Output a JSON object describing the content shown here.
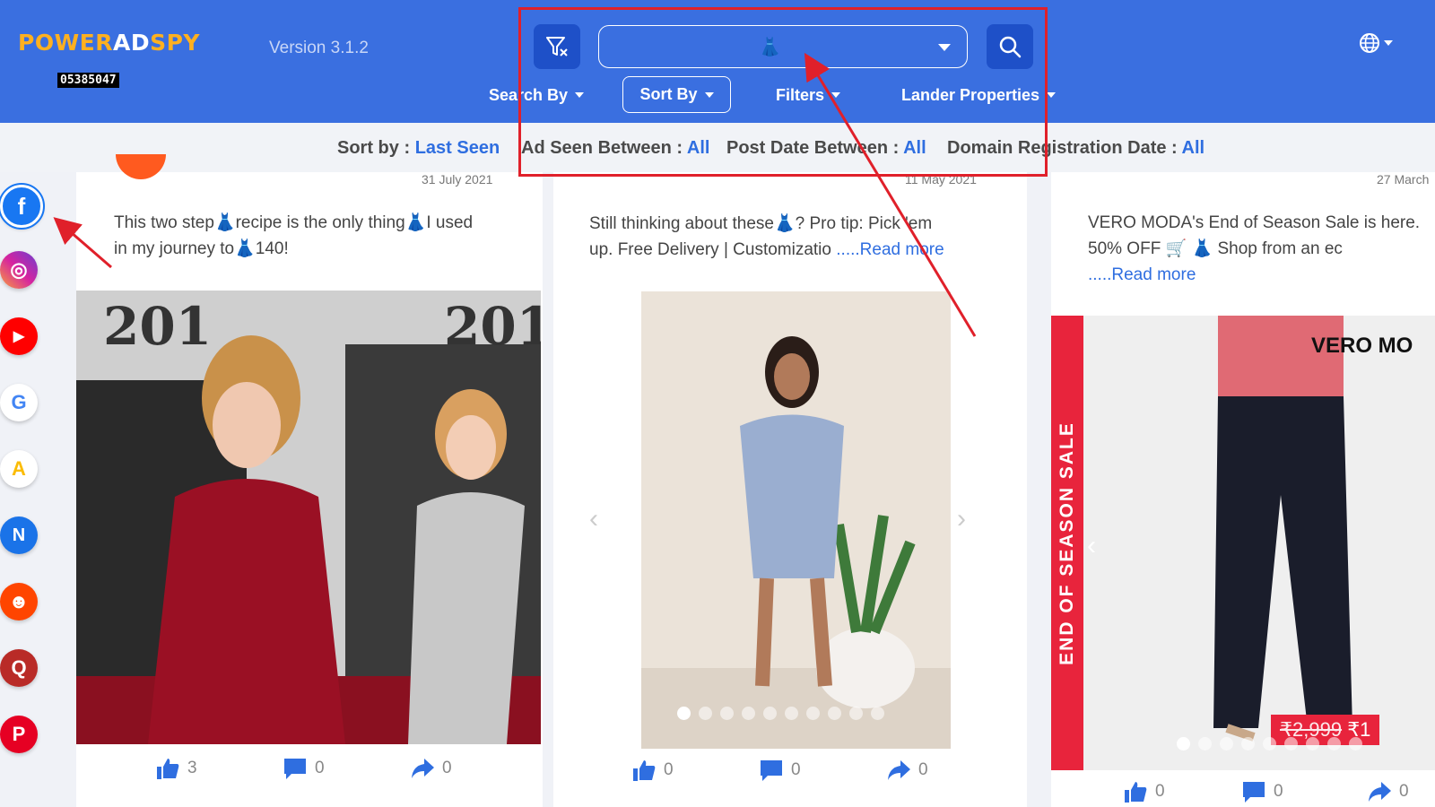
{
  "header": {
    "logo_part1": "POWER",
    "logo_part2": "AD",
    "logo_part3": "SPY",
    "user_id": "05385047",
    "version": "Version 3.1.2",
    "search_emoji": "👗",
    "menu": {
      "search_by": "Search By",
      "sort_by": "Sort By",
      "filters": "Filters",
      "lander_properties": "Lander Properties"
    }
  },
  "subbar": {
    "sort_label": "Sort by :",
    "sort_value": "Last Seen",
    "ad_seen_label": "Ad Seen Between :",
    "ad_seen_value": "All",
    "post_date_label": "Post Date Between :",
    "post_date_value": "All",
    "domain_reg_label": "Domain Registration Date :",
    "domain_reg_value": "All"
  },
  "sidebar": {
    "items": [
      {
        "name": "facebook",
        "glyph": "f",
        "color": "#1877f2"
      },
      {
        "name": "instagram",
        "glyph": "◎",
        "color": "#d6249f"
      },
      {
        "name": "youtube",
        "glyph": "▶",
        "color": "#ff0000"
      },
      {
        "name": "google",
        "glyph": "G",
        "color": "#ffffff"
      },
      {
        "name": "google-ads",
        "glyph": "A",
        "color": "#ffffff"
      },
      {
        "name": "native",
        "glyph": "N",
        "color": "#1a73e8"
      },
      {
        "name": "reddit",
        "glyph": "☻",
        "color": "#ff4500"
      },
      {
        "name": "quora",
        "glyph": "Q",
        "color": "#b92b27"
      },
      {
        "name": "pinterest",
        "glyph": "P",
        "color": "#e60023"
      }
    ]
  },
  "cards": [
    {
      "date": "31 July 2021",
      "text_line1_a": "This two step",
      "text_line1_b": "recipe is the only thing",
      "text_line1_c": "I used",
      "text_line2_a": "in my journey to",
      "text_line2_b": "140!",
      "emoji": "👗",
      "likes": "3",
      "comments": "0",
      "shares": "0"
    },
    {
      "date": "11 May 2021",
      "text_line1_a": "Still thinking about these",
      "text_line1_b": "? Pro tip: Pick 'em",
      "text_line2_a": "up. Free Delivery | Customizatio",
      "read_more": ".....Read more",
      "emoji": "👗",
      "likes": "0",
      "comments": "0",
      "shares": "0"
    },
    {
      "date": "27 March",
      "text_line1": "VERO MODA's End of Season Sale is here.",
      "text_line2_a": "50%  OFF",
      "text_line2_b": "Shop  from  an  ec",
      "read_more": ".....Read more",
      "emoji": "👗",
      "cart_emoji": "🛒",
      "banner_text": "END OF SEASON SALE",
      "brand": "VERO MO",
      "price_old": "₹2,999",
      "price_new": "₹1",
      "likes": "0",
      "comments": "0",
      "shares": "0"
    }
  ]
}
